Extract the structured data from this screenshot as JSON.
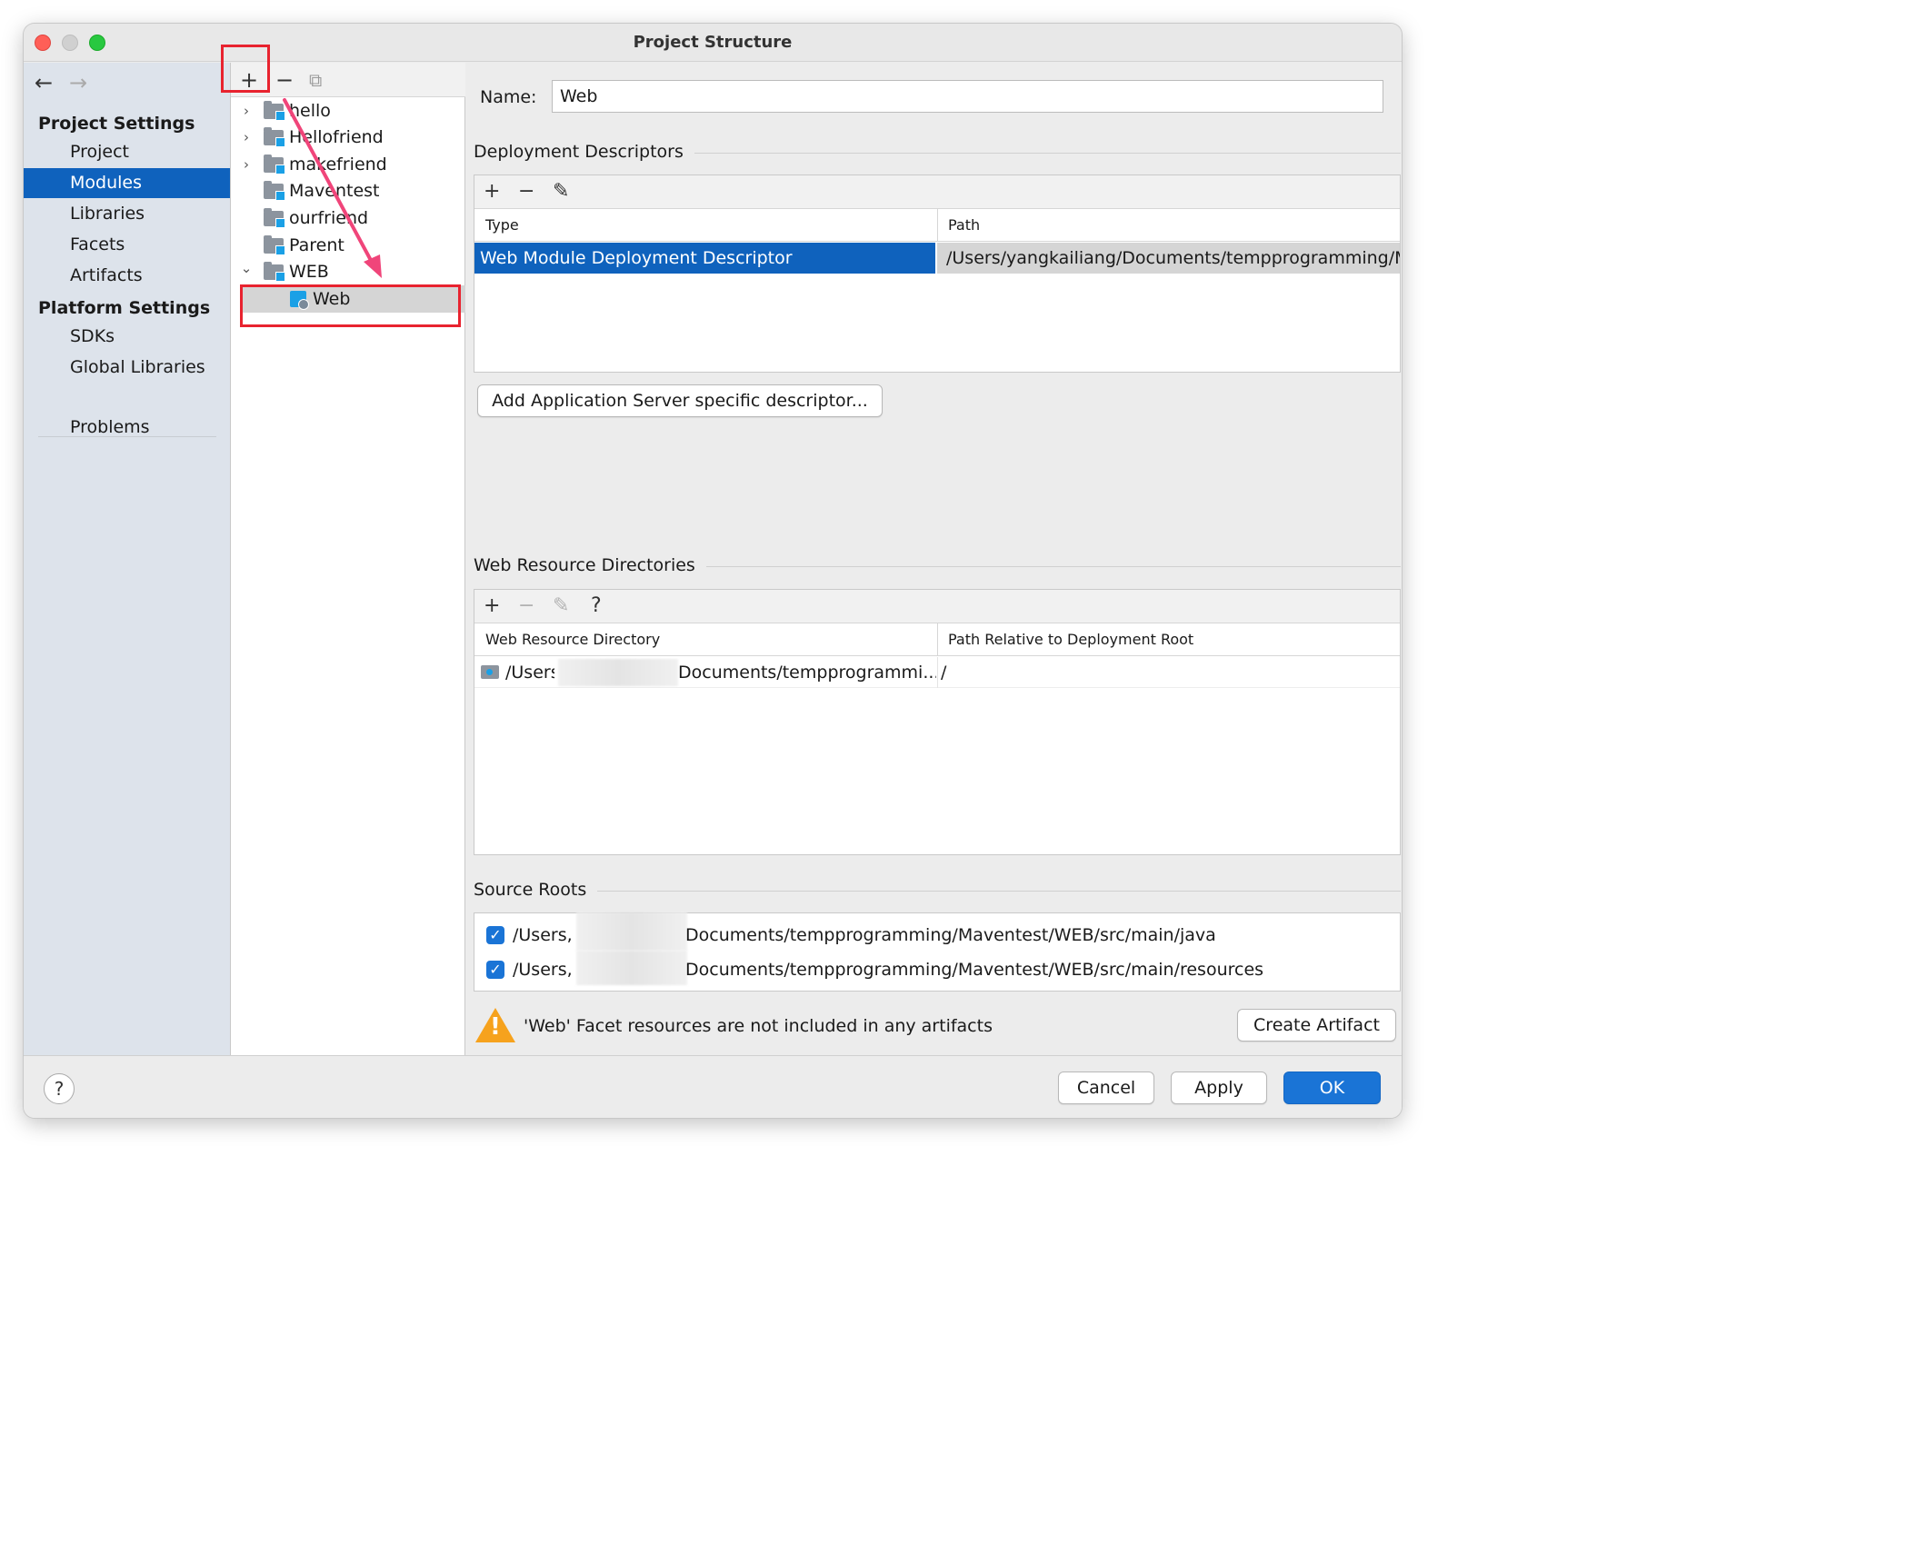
{
  "window": {
    "title": "Project Structure"
  },
  "nav": {
    "back_glyph": "←",
    "forward_glyph": "→",
    "project_settings_heading": "Project Settings",
    "platform_settings_heading": "Platform Settings",
    "items": {
      "project": "Project",
      "modules": "Modules",
      "libraries": "Libraries",
      "facets": "Facets",
      "artifacts": "Artifacts",
      "sdks": "SDKs",
      "global_libraries": "Global Libraries",
      "problems": "Problems"
    },
    "selected": "Modules"
  },
  "modules": {
    "toolbar": {
      "add": "+",
      "remove": "−",
      "copy": "⧉"
    },
    "tree": [
      {
        "label": "hello",
        "expandable": true,
        "expanded": false
      },
      {
        "label": "Hellofriend",
        "expandable": true,
        "expanded": false
      },
      {
        "label": "makefriend",
        "expandable": true,
        "expanded": false
      },
      {
        "label": "Maventest",
        "expandable": false
      },
      {
        "label": "ourfriend",
        "expandable": false
      },
      {
        "label": "Parent",
        "expandable": false
      },
      {
        "label": "WEB",
        "expandable": true,
        "expanded": true
      },
      {
        "label": "Web",
        "child": true,
        "selected": true
      }
    ],
    "chevron_collapsed": "›",
    "chevron_expanded": "⌄"
  },
  "facet": {
    "name_label": "Name:",
    "name_value": "Web",
    "deployment": {
      "title": "Deployment Descriptors",
      "toolbar": {
        "add": "+",
        "remove": "−",
        "edit": "✎"
      },
      "columns": [
        "Type",
        "Path"
      ],
      "rows": [
        {
          "type": "Web Module Deployment Descriptor",
          "path": "/Users/yangkailiang/Documents/tempprogramming/Ma"
        }
      ],
      "add_button": "Add Application Server specific descriptor..."
    },
    "web_resources": {
      "title": "Web Resource Directories",
      "toolbar": {
        "add": "+",
        "remove": "−",
        "edit": "✎",
        "help": "?"
      },
      "columns": [
        "Web Resource Directory",
        "Path Relative to Deployment Root"
      ],
      "rows": [
        {
          "dir_prefix": "/Users",
          "dir_suffix": "Documents/tempprogrammi...",
          "relative": "/"
        }
      ]
    },
    "source_roots": {
      "title": "Source Roots",
      "rows": [
        {
          "prefix": "/Users,",
          "suffix": "Documents/tempprogramming/Maventest/WEB/src/main/java",
          "checked": true
        },
        {
          "prefix": "/Users,",
          "suffix": "Documents/tempprogramming/Maventest/WEB/src/main/resources",
          "checked": true
        }
      ]
    },
    "warning": {
      "message": "'Web' Facet resources are not included in any artifacts",
      "button": "Create Artifact"
    }
  },
  "footer": {
    "help": "?",
    "cancel": "Cancel",
    "apply": "Apply",
    "ok": "OK"
  },
  "colors": {
    "selection": "#0f62bd",
    "annotation_red": "#e8232f",
    "annotation_arrow": "#f0457a",
    "module_badge": "#1aa0e6"
  },
  "checkmark": "✓"
}
